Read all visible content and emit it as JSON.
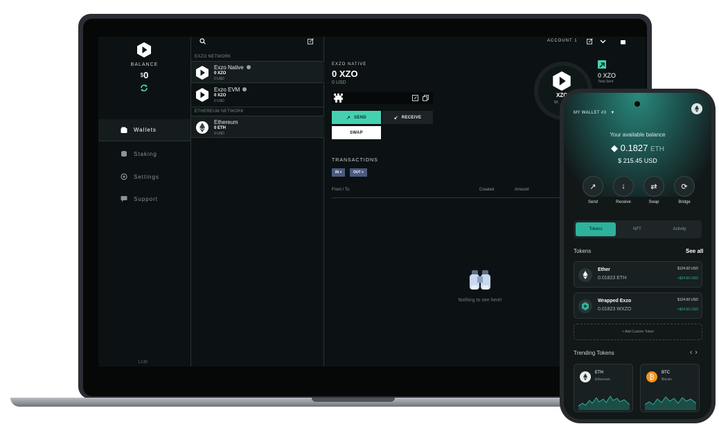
{
  "desktop": {
    "sidebar": {
      "balance_label": "BALANCE",
      "balance_currency": "$",
      "balance_value": "0",
      "nav": [
        {
          "label": "Wallets",
          "icon": "wallet-icon",
          "active": true
        },
        {
          "label": "Staking",
          "icon": "coins-icon",
          "active": false
        },
        {
          "label": "Settings",
          "icon": "gear-icon",
          "active": false
        },
        {
          "label": "Support",
          "icon": "chat-icon",
          "active": false
        }
      ],
      "version": "1.2.82"
    },
    "wallets": {
      "network1_label": "EXZO NETWORK",
      "network2_label": "ETHEREUM NETWORK",
      "items": [
        {
          "name": "Exzo Native",
          "amount": "0 XZO",
          "usd": "0 USD"
        },
        {
          "name": "Exzo EVM",
          "amount": "0 XZO",
          "usd": "0 USD"
        },
        {
          "name": "Ethereum",
          "amount": "0 ETH",
          "usd": "0 USD"
        }
      ]
    },
    "header": {
      "account_label": "ACCOUNT 1"
    },
    "detail": {
      "label": "EXZO NATIVE",
      "amount": "0 XZO",
      "usd": "0 USD",
      "send_label": "SEND",
      "receive_label": "RECEIVE",
      "swap_label": "SWAP",
      "hero_symbol": "XZO",
      "hero_sub": "$0.",
      "total_sent_amount": "0 XZO",
      "total_sent_label": "Total Sent"
    },
    "transactions": {
      "title": "TRANSACTIONS",
      "filters": [
        "IN ×",
        "OUT ×"
      ],
      "columns": [
        "From / To",
        "Created",
        "Amount"
      ],
      "empty_text": "Nothing to see here!"
    }
  },
  "mobile": {
    "wallet_name": "MY WALLET #3",
    "available_label": "Your available balance",
    "balance_amount": "0.1827",
    "balance_unit": "ETH",
    "balance_usd": "$ 215.45 USD",
    "actions": [
      "Send",
      "Receive",
      "Swap",
      "Bridge"
    ],
    "tabs": [
      "Tokens",
      "NFT",
      "Activity"
    ],
    "tokens_heading": "Tokens",
    "see_all": "See all",
    "tokens": [
      {
        "name": "Ether",
        "amount": "0.01823 ETH",
        "usd": "$124.00 USD",
        "change": "+$24.00 USD"
      },
      {
        "name": "Wrapped Exzo",
        "amount": "0.01823 WXZO",
        "usd": "$124.00 USD",
        "change": "+$24.00 USD"
      }
    ],
    "add_custom_token": "+ Add Custom Token",
    "trending_heading": "Trending Tokens",
    "trending": [
      {
        "symbol": "ETH",
        "name": "Ethereum",
        "color": "#e8eeee"
      },
      {
        "symbol": "BTC",
        "name": "Bitcoin",
        "color": "#f7931a"
      }
    ]
  },
  "colors": {
    "accent": "#45d1b0",
    "chip": "#4b5a80"
  }
}
